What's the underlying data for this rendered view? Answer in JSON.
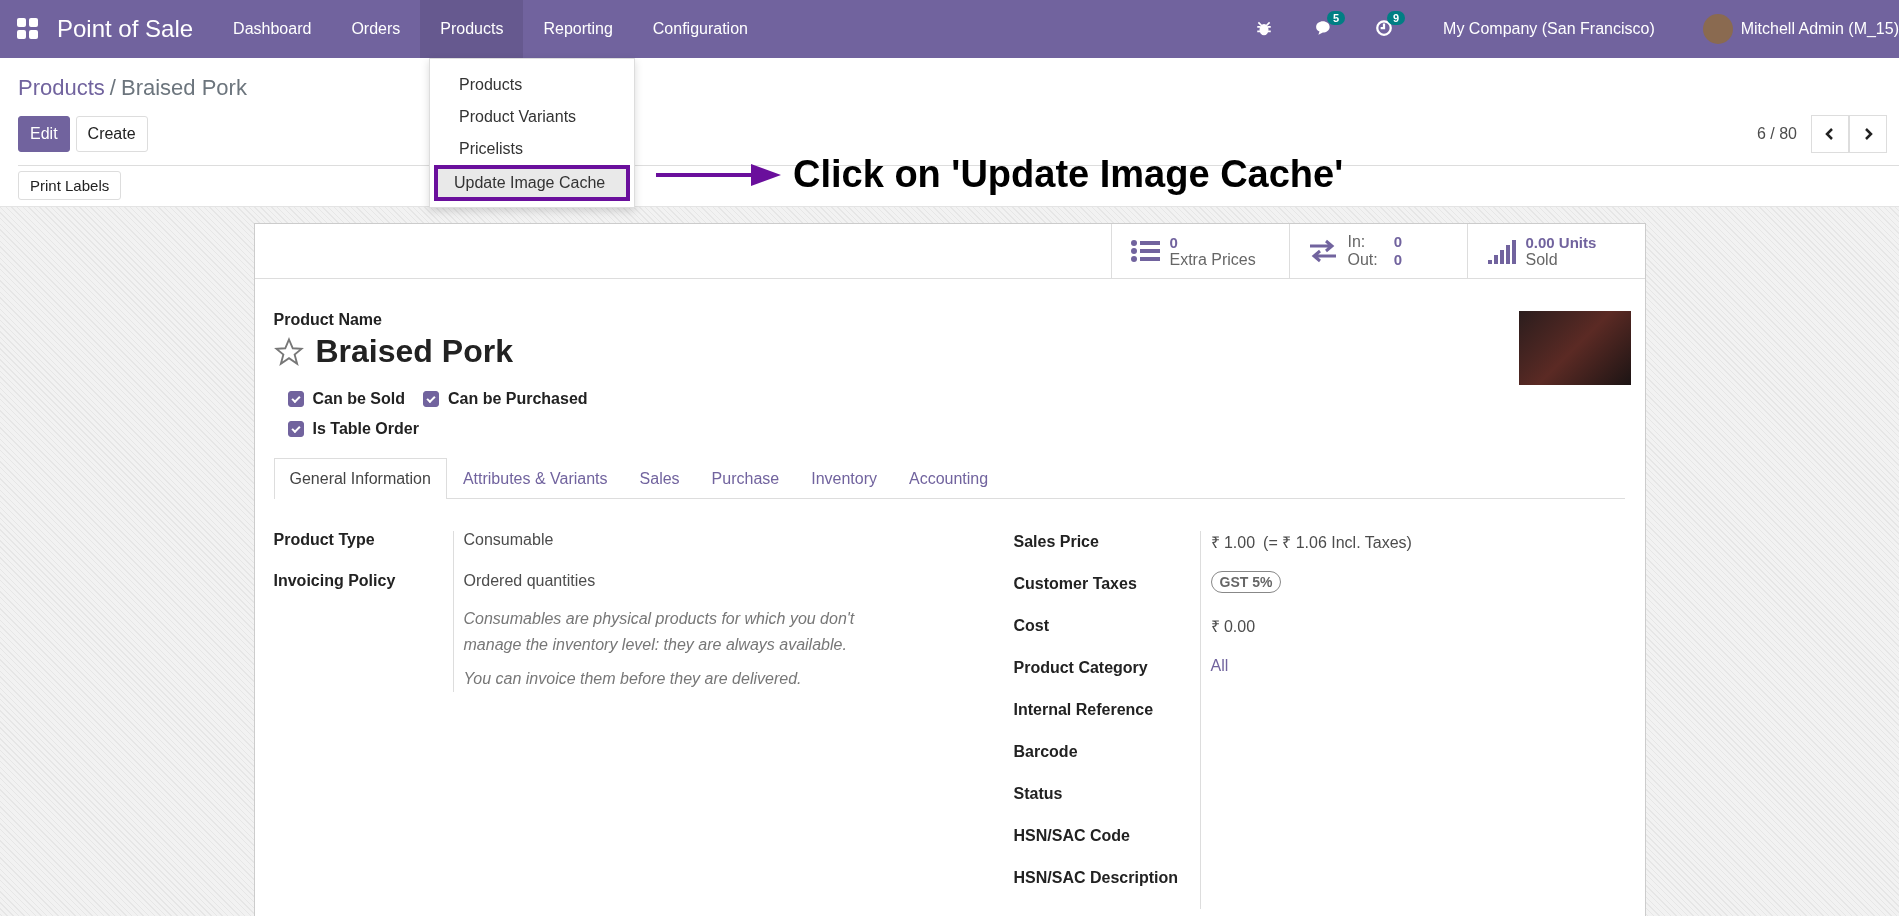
{
  "navbar": {
    "app_name": "Point of Sale",
    "menu": [
      {
        "label": "Dashboard",
        "selected": false
      },
      {
        "label": "Orders",
        "selected": false
      },
      {
        "label": "Products",
        "selected": true
      },
      {
        "label": "Reporting",
        "selected": false
      },
      {
        "label": "Configuration",
        "selected": false
      }
    ],
    "systray": [
      {
        "kind": "bug"
      },
      {
        "kind": "chat",
        "badge": "5"
      },
      {
        "kind": "clock",
        "badge": "9"
      }
    ],
    "company": "My Company (San Francisco)",
    "user": "Mitchell Admin (M_15)"
  },
  "dropdown": {
    "items": [
      {
        "label": "Products",
        "selected": false
      },
      {
        "label": "Product Variants",
        "selected": false
      },
      {
        "label": "Pricelists",
        "selected": false
      },
      {
        "label": "Update Image Cache",
        "selected": true
      }
    ]
  },
  "annotation": {
    "text": "Click on 'Update Image Cache'"
  },
  "breadcrumb_separator": "/",
  "breadcrumbs": [
    {
      "label": "Products",
      "kind": "link"
    },
    {
      "label": "Braised Pork",
      "kind": "current"
    }
  ],
  "buttons": [
    {
      "label": "Edit",
      "kind": "primary"
    },
    {
      "label": "Create",
      "kind": "secondary"
    }
  ],
  "pager": {
    "text": "6 / 80"
  },
  "action_buttons": [
    "Print Labels"
  ],
  "stat_buttons": [
    {
      "kind": "list",
      "value": "0",
      "label": "Extra Prices"
    },
    {
      "kind": "transfer",
      "lines": [
        {
          "label": "In:",
          "value": "0"
        },
        {
          "label": "Out:",
          "value": "0"
        }
      ]
    },
    {
      "kind": "signal",
      "value": "0.00 Units",
      "label": "Sold"
    }
  ],
  "form": {
    "name_label": "Product Name",
    "name": "Braised Pork",
    "favorite": false,
    "checkboxes": [
      {
        "label": "Can be Sold",
        "checked": true
      },
      {
        "label": "Can be Purchased",
        "checked": true
      },
      {
        "label": "Is Table Order",
        "checked": true
      }
    ],
    "tabs": [
      {
        "label": "General Information",
        "selected": true
      },
      {
        "label": "Attributes & Variants",
        "selected": false
      },
      {
        "label": "Sales",
        "selected": false
      },
      {
        "label": "Purchase",
        "selected": false
      },
      {
        "label": "Inventory",
        "selected": false
      },
      {
        "label": "Accounting",
        "selected": false
      }
    ],
    "left_fields": [
      {
        "label": "Product Type",
        "value": "Consumable"
      },
      {
        "label": "Invoicing Policy",
        "value": "Ordered quantities",
        "notes": [
          "Consumables are physical products for which you don't manage the inventory level: they are always available.",
          "You can invoice them before they are delivered."
        ]
      }
    ],
    "right_fields": [
      {
        "label": "Sales Price",
        "kind": "text",
        "value": "₹ 1.00",
        "extra": "(= ₹ 1.06 Incl. Taxes)"
      },
      {
        "label": "Customer Taxes",
        "kind": "tag",
        "value": "GST 5%"
      },
      {
        "label": "Cost",
        "kind": "text",
        "value": "₹ 0.00"
      },
      {
        "label": "Product Category",
        "kind": "link",
        "value": "All"
      },
      {
        "label": "Internal Reference",
        "kind": "empty"
      },
      {
        "label": "Barcode",
        "kind": "empty"
      },
      {
        "label": "Status",
        "kind": "empty"
      },
      {
        "label": "HSN/SAC Code",
        "kind": "empty"
      },
      {
        "label": "HSN/SAC Description",
        "kind": "empty"
      }
    ]
  }
}
